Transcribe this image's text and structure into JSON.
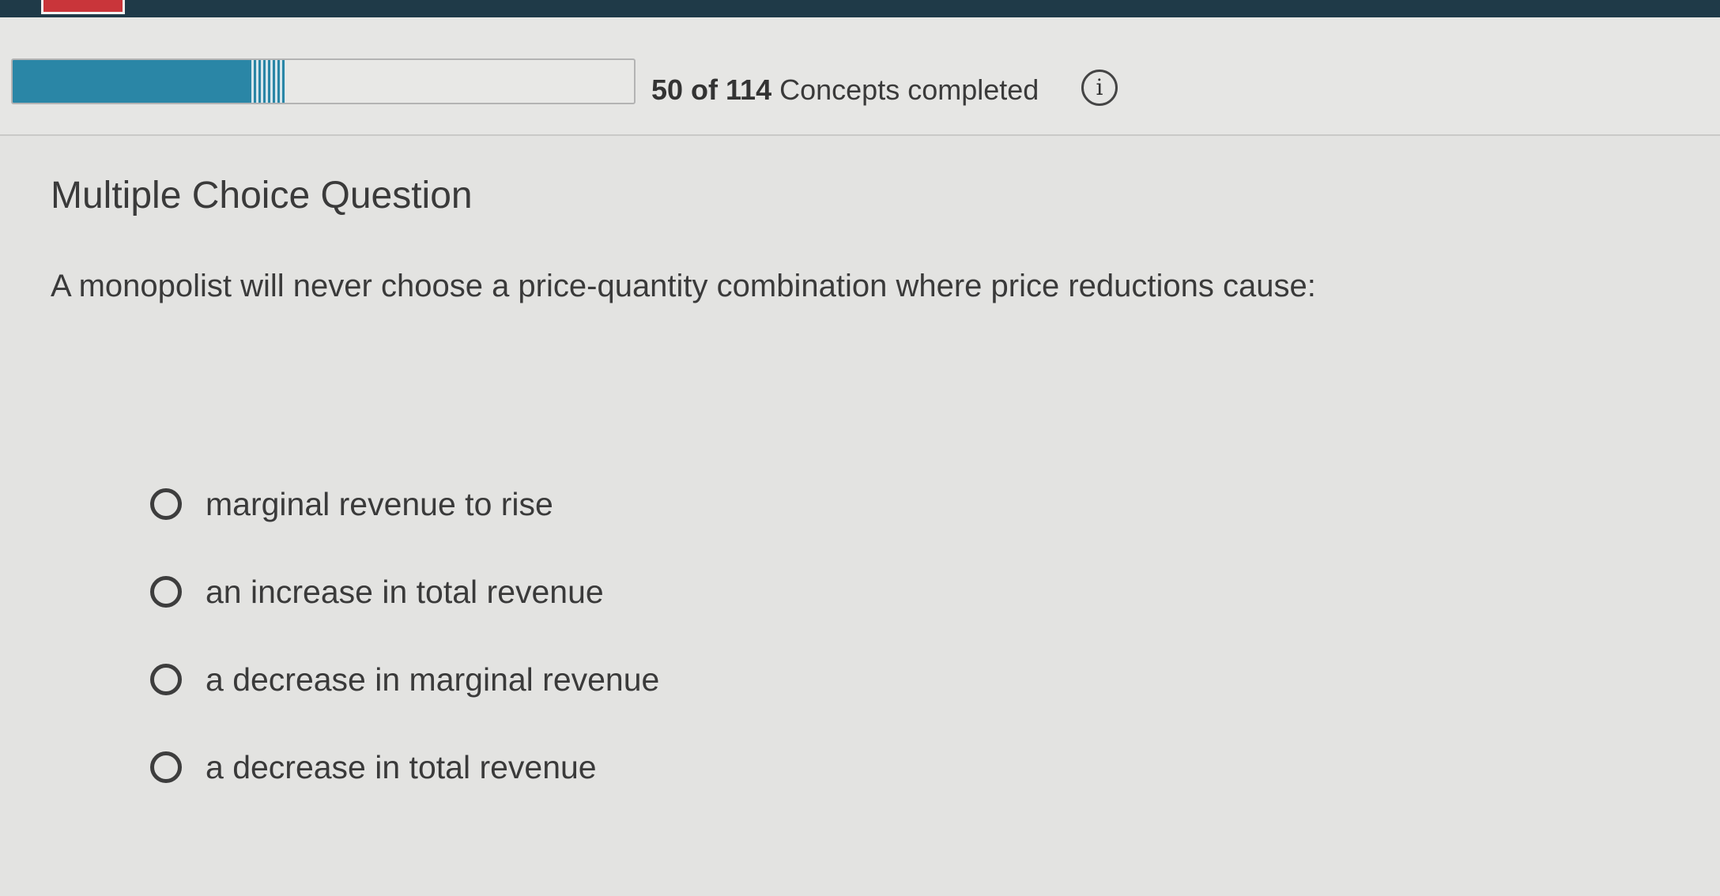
{
  "progress": {
    "completed": "50 of 114",
    "suffix": " Concepts completed",
    "fraction": 0.4386,
    "info_icon": "info-circle-icon",
    "fill_color": "#2a86a6"
  },
  "question": {
    "type_heading": "Multiple Choice Question",
    "prompt": "A monopolist will never choose a price-quantity combination where price reductions cause:",
    "options": [
      {
        "label": "marginal revenue to rise",
        "selected": false
      },
      {
        "label": "an increase in total revenue",
        "selected": false
      },
      {
        "label": "a decrease in marginal revenue",
        "selected": false
      },
      {
        "label": "a decrease in total revenue",
        "selected": false
      }
    ]
  }
}
